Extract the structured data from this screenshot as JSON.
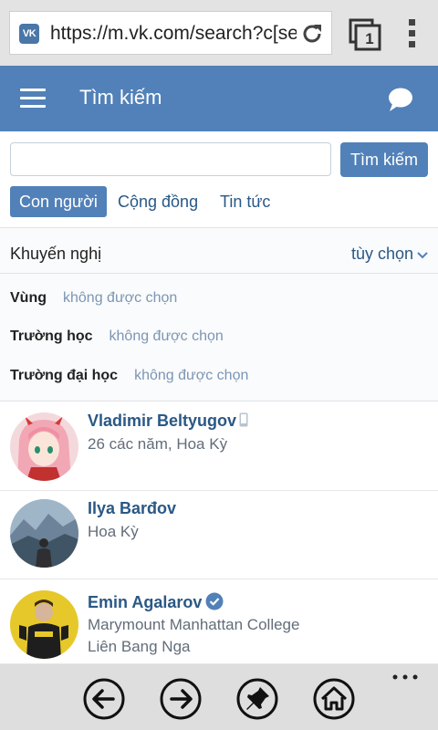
{
  "browser": {
    "favicon_text": "VK",
    "url": "https://m.vk.com/search?c[se",
    "tab_count": "1"
  },
  "header": {
    "title": "Tìm kiếm"
  },
  "search": {
    "input_value": "",
    "button_label": "Tìm kiếm",
    "tabs": [
      {
        "label": "Con người",
        "active": true
      },
      {
        "label": "Cộng đồng",
        "active": false
      },
      {
        "label": "Tin tức",
        "active": false
      }
    ]
  },
  "recommendations": {
    "label": "Khuyến nghị",
    "options_label": "tùy chọn"
  },
  "filters": [
    {
      "name": "Vùng",
      "value": "không được chọn"
    },
    {
      "name": "Trường học",
      "value": "không được chọn"
    },
    {
      "name": "Trường đại học",
      "value": "không được chọn"
    }
  ],
  "people": [
    {
      "name": "Vladimir Beltyugov",
      "info": [
        "26 các năm, Hoa Kỳ"
      ],
      "badge": "mobile-icon"
    },
    {
      "name": "Ilya Barđov",
      "info": [
        "Hoa Kỳ"
      ],
      "badge": ""
    },
    {
      "name": "Emin Agalarov",
      "info": [
        "Marymount Manhattan College",
        "Liên Bang Nga"
      ],
      "badge": "verified-icon"
    }
  ],
  "colors": {
    "vk_blue": "#5181b8",
    "link_blue": "#2a5885",
    "muted_blue": "#7c95b4"
  }
}
